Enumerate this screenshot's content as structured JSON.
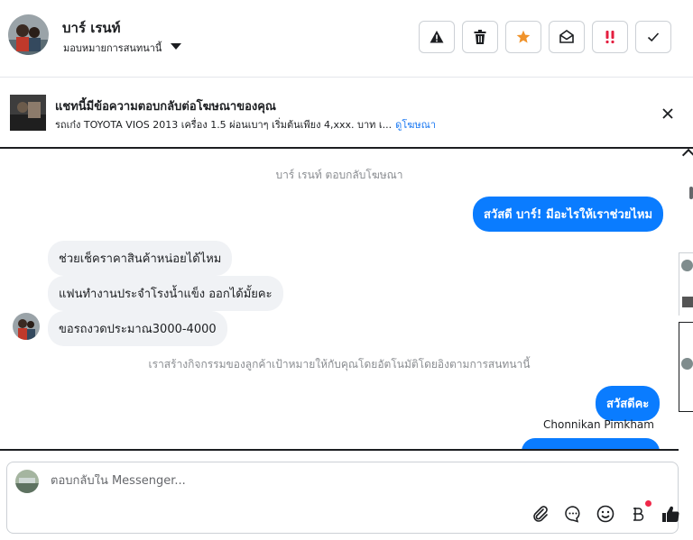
{
  "header": {
    "contact_name": "บาร์ เรนท์",
    "assign_label": "มอบหมายการสนทนานี้",
    "actions": [
      {
        "icon": "warning-icon"
      },
      {
        "icon": "trash-icon"
      },
      {
        "icon": "star-icon",
        "color": "#f0932b"
      },
      {
        "icon": "mark-unread-icon"
      },
      {
        "icon": "follow-up-icon",
        "color": "#e41e3f"
      },
      {
        "icon": "check-icon"
      }
    ]
  },
  "ad": {
    "title": "แชทนี้มีข้อความตอบกลับต่อโฆษณาของคุณ",
    "description": "รถเก๋ง TOYOTA VIOS 2013 เครื่อง 1.5 ผ่อนเบาๆ เริ่มต้นเพียง 4,xxx. บาท เ...",
    "link": "ดูโฆษณา"
  },
  "chat": {
    "reply_note": "บาร์ เรนท์ ตอบกลับโฆษณา",
    "out_greeting": "สวัสดี บาร์! มีอะไรให้เราช่วยไหม",
    "in_messages": [
      "ช่วยเช็คราคาสินค้าหน่อยได้ไหม",
      "แฟนทำงานประจำโรงน้ำแข็ง ออกได้มั้ยคะ",
      "ขอรถงวดประมาณ3000-4000"
    ],
    "activity_note": "เราสร้างกิจกรรมของลูกค้าเป้าหมายให้กับคุณโดยอัตโนมัติโดยอิงตามการสนทนานี้",
    "out_reply": "สวัสดีคะ",
    "sender_name": "Chonnikan Pimkham"
  },
  "composer": {
    "placeholder": "ตอบกลับใน Messenger...",
    "tools": [
      "attachment-icon",
      "saved-reply-icon",
      "emoji-icon",
      "baht-payment-icon",
      "thumbs-up-icon"
    ]
  },
  "colors": {
    "accent": "#0a7cff",
    "link": "#1877f2",
    "incoming_bubble": "#f0f2f5"
  }
}
